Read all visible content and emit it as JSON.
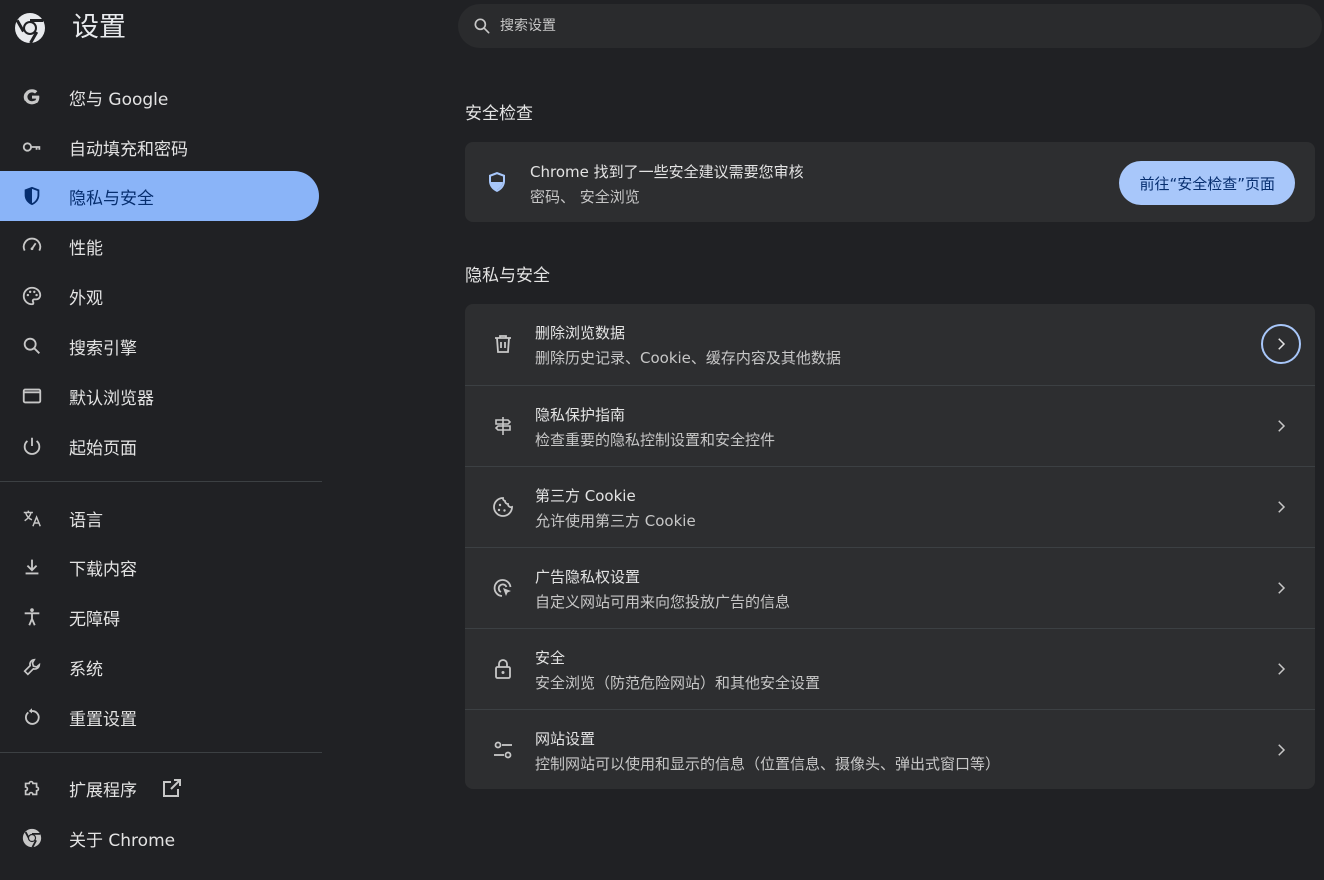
{
  "header": {
    "title": "设置",
    "logo_icon": "chrome-logo-icon"
  },
  "search": {
    "placeholder": "搜索设置",
    "value": ""
  },
  "sidebar": {
    "active_index": 2,
    "items": [
      {
        "label": "您与 Google",
        "icon": "google-g-icon"
      },
      {
        "label": "自动填充和密码",
        "icon": "key-icon"
      },
      {
        "label": "隐私与安全",
        "icon": "shield-icon"
      },
      {
        "label": "性能",
        "icon": "speedometer-icon"
      },
      {
        "label": "外观",
        "icon": "palette-icon"
      },
      {
        "label": "搜索引擎",
        "icon": "search-icon"
      },
      {
        "label": "默认浏览器",
        "icon": "browser-window-icon"
      },
      {
        "label": "起始页面",
        "icon": "power-icon"
      },
      {
        "label": "语言",
        "icon": "translate-icon"
      },
      {
        "label": "下载内容",
        "icon": "download-icon"
      },
      {
        "label": "无障碍",
        "icon": "accessibility-icon"
      },
      {
        "label": "系统",
        "icon": "wrench-icon"
      },
      {
        "label": "重置设置",
        "icon": "reset-icon"
      },
      {
        "label": "扩展程序",
        "icon": "puzzle-icon"
      },
      {
        "label": "关于 Chrome",
        "icon": "chrome-logo-icon"
      }
    ]
  },
  "safety_check": {
    "section_title": "安全检查",
    "headline": "Chrome 找到了一些安全建议需要您审核",
    "detail": "密码、 安全浏览",
    "button_label": "前往“安全检查”页面"
  },
  "privacy": {
    "section_title": "隐私与安全",
    "rows": [
      {
        "title": "删除浏览数据",
        "subtitle": "删除历史记录、Cookie、缓存内容及其他数据",
        "icon": "trash-icon"
      },
      {
        "title": "隐私保护指南",
        "subtitle": "检查重要的隐私控制设置和安全控件",
        "icon": "signpost-icon"
      },
      {
        "title": "第三方 Cookie",
        "subtitle": "允许使用第三方 Cookie",
        "icon": "cookie-icon"
      },
      {
        "title": "广告隐私权设置",
        "subtitle": "自定义网站可用来向您投放广告的信息",
        "icon": "ad-privacy-icon"
      },
      {
        "title": "安全",
        "subtitle": "安全浏览（防范危险网站）和其他安全设置",
        "icon": "lock-icon"
      },
      {
        "title": "网站设置",
        "subtitle": "控制网站可以使用和显示的信息（位置信息、摄像头、弹出式窗口等）",
        "icon": "tune-icon"
      }
    ]
  },
  "colors": {
    "background": "#202124",
    "active_nav": "#8ab4f8",
    "button": "#a8c7fa",
    "card": "#2d2e30"
  }
}
